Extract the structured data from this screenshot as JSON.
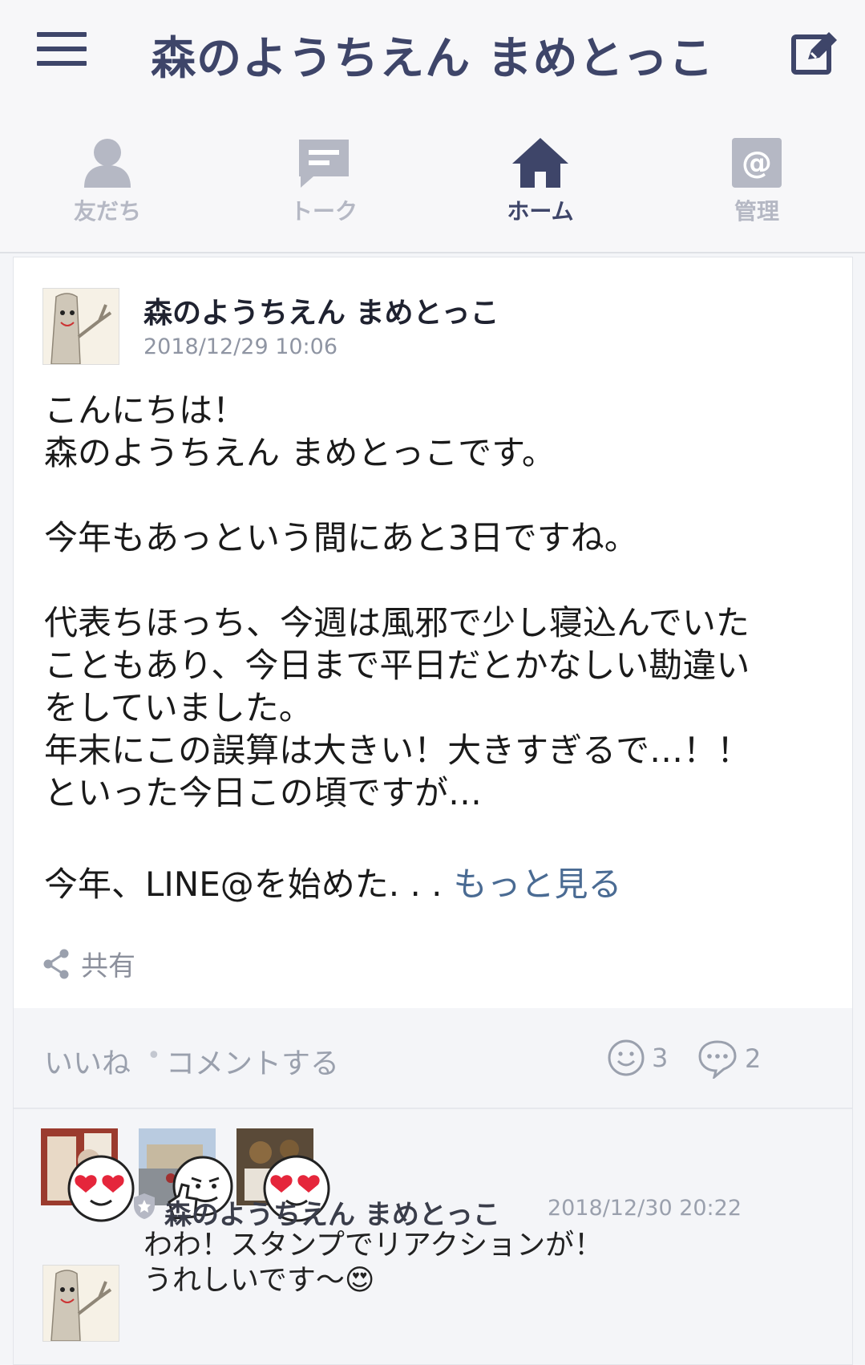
{
  "header": {
    "title": "森のようちえん まめとっこ"
  },
  "tabs": [
    {
      "label": "友だち",
      "icon": "person-icon"
    },
    {
      "label": "トーク",
      "icon": "chat-bubble-icon"
    },
    {
      "label": "ホーム",
      "icon": "home-icon",
      "active": true
    },
    {
      "label": "管理",
      "icon": "at-sign-icon"
    }
  ],
  "post": {
    "author": "森のようちえん まめとっこ",
    "timestamp": "2018/12/29 10:06",
    "body": "こんにちは！\n森のようちえん まめとっこです。\n\n今年もあっという間にあと3日ですね。\n\n代表ちほっち、今週は風邪で少し寝込んでいた\nこともあり、今日まで平日だとかなしい勘違い\nをしていました。\n年末にこの誤算は大きい！大きすぎるで…！！\nといった今日この頃ですが…",
    "truncated_line": "今年、LINE@を始めた. . .",
    "more_label": "もっと見る",
    "share_label": "共有"
  },
  "actions": {
    "like_label": "いいね",
    "separator": "•",
    "comment_label": "コメントする",
    "reaction_count": "3",
    "comment_count": "2"
  },
  "reactions": [
    {
      "sticker": "heart-eyes-face-icon"
    },
    {
      "sticker": "thumbs-up-face-icon"
    },
    {
      "sticker": "heart-eyes-face-icon"
    }
  ],
  "comment": {
    "author": "森のようちえん まめとっこ",
    "timestamp": "2018/12/30 20:22",
    "text": "わわ！スタンプでリアクションが！\nうれしいです〜😍"
  },
  "colors": {
    "brand_navy": "#3e4569",
    "link_blue": "#4a6b93",
    "muted_gray": "#9aa0ad"
  }
}
